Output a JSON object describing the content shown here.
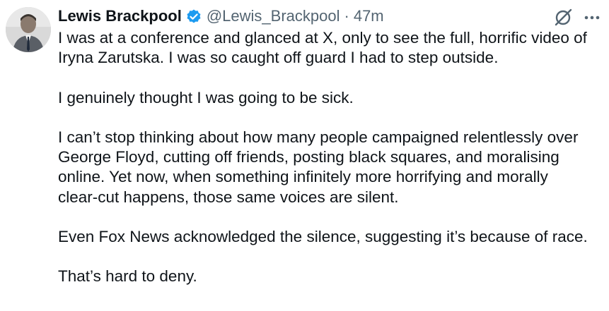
{
  "tweet": {
    "author": {
      "display_name": "Lewis Brackpool",
      "handle": "@Lewis_Brackpool",
      "separator": "·",
      "timestamp": "47m",
      "verified_icon": "verified-badge-icon",
      "verified_color": "#1d9bf0"
    },
    "actions": {
      "grok_icon": "grok-icon",
      "more_icon": "more-options-icon"
    },
    "paragraphs": [
      {
        "lines": [
          "I was at a conference and glanced at X, only to see the full, horrific video of",
          "Iryna Zarutska. I was so caught off guard I had to step outside."
        ]
      },
      {
        "lines": [
          "I genuinely thought I was going to be sick."
        ]
      },
      {
        "lines": [
          "I can’t stop thinking about how many people campaigned relentlessly over",
          "George Floyd, cutting off friends, posting black squares, and moralising",
          "online. Yet now, when something infinitely more horrifying and morally",
          "clear-cut happens, those same voices are silent."
        ]
      },
      {
        "lines": [
          "Even Fox News acknowledged the silence, suggesting it’s because of race."
        ]
      },
      {
        "lines": [
          "That’s hard to deny."
        ]
      }
    ]
  }
}
